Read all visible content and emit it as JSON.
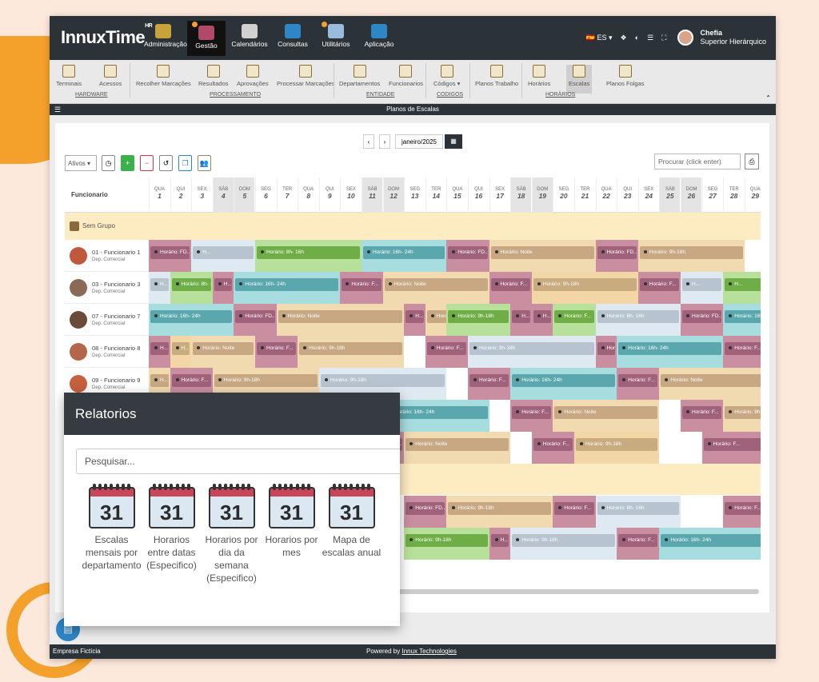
{
  "app": {
    "logo": "InnuxTime",
    "logo_sup": "HR"
  },
  "topnav": [
    {
      "label": "Administração",
      "icon": "gear-sun-icon",
      "alert": false
    },
    {
      "label": "Gestão",
      "icon": "network-icon",
      "alert": true,
      "active": true
    },
    {
      "label": "Calendários",
      "icon": "calendar-icon",
      "alert": false
    },
    {
      "label": "Consultas",
      "icon": "search-doc-icon",
      "alert": false
    },
    {
      "label": "Utilitários",
      "icon": "tools-icon",
      "alert": true
    },
    {
      "label": "Aplicação",
      "icon": "info-icon",
      "alert": false
    }
  ],
  "topright": {
    "lang": "ES",
    "user_role": "Chefia",
    "user_title": "Superior Hierárquico"
  },
  "ribbon": {
    "items": [
      "Terminais",
      "Acessos",
      "Recolher Marcações",
      "Resultados",
      "Aprovações",
      "Processar Marcações",
      "Departamentos",
      "Funcionarios",
      "Códigos ▾",
      "Planos Trabalho",
      "Horários",
      "Escalas",
      "Planos Folgas"
    ],
    "groups": [
      "HARDWARE",
      "PROCESSAMENTO",
      "ENTIDADE",
      "CODIGOS",
      "HORÁRIOS"
    ]
  },
  "title": "Planos de Escalas",
  "month": {
    "value": "janeiro/2025",
    "prev": "‹",
    "next": "›"
  },
  "toolbar": {
    "filter": "Ativos",
    "search_placeholder": "Procurar (click enter)"
  },
  "grid": {
    "col_header": "Funcionario",
    "days": [
      {
        "n": "QUA",
        "d": "1"
      },
      {
        "n": "QUI",
        "d": "2"
      },
      {
        "n": "SEX",
        "d": "3"
      },
      {
        "n": "SÁB",
        "d": "4"
      },
      {
        "n": "DOM",
        "d": "5"
      },
      {
        "n": "SEG",
        "d": "6"
      },
      {
        "n": "TER",
        "d": "7"
      },
      {
        "n": "QUA",
        "d": "8"
      },
      {
        "n": "QUI",
        "d": "9"
      },
      {
        "n": "SEX",
        "d": "10"
      },
      {
        "n": "SÁB",
        "d": "11"
      },
      {
        "n": "DOM",
        "d": "12"
      },
      {
        "n": "SEG",
        "d": "13"
      },
      {
        "n": "TER",
        "d": "14"
      },
      {
        "n": "QUA",
        "d": "15"
      },
      {
        "n": "QUI",
        "d": "16"
      },
      {
        "n": "SEX",
        "d": "17"
      },
      {
        "n": "SÁB",
        "d": "18"
      },
      {
        "n": "DOM",
        "d": "19"
      },
      {
        "n": "SEG",
        "d": "20"
      },
      {
        "n": "TER",
        "d": "21"
      },
      {
        "n": "QUA",
        "d": "22"
      },
      {
        "n": "QUI",
        "d": "23"
      },
      {
        "n": "SEX",
        "d": "24"
      },
      {
        "n": "SÁB",
        "d": "25"
      },
      {
        "n": "DOM",
        "d": "26"
      },
      {
        "n": "SEG",
        "d": "27"
      },
      {
        "n": "TER",
        "d": "28"
      },
      {
        "n": "QUA",
        "d": "29"
      }
    ],
    "group": "Sem Grupo",
    "employees": [
      {
        "name": "01 - Funcionario 1",
        "dept": "Dep. Comercial",
        "av": "#c0583b"
      },
      {
        "name": "03 - Funcionario 3",
        "dept": "Dep. Comercial",
        "av": "#8a6a55"
      },
      {
        "name": "07 - Funcionario 7",
        "dept": "Dep. Comercial",
        "av": "#6b4a3a"
      },
      {
        "name": "08 - Funcionario 8",
        "dept": "Dep. Comercial",
        "av": "#b5664a"
      },
      {
        "name": "09 - Funcionario 9",
        "dept": "Dep. Comercial",
        "av": "#c8603d"
      }
    ],
    "shift_labels": [
      "Horário: FD...",
      "Horário: 8h- 16h",
      "Horário: 16h- 24h",
      "Horário: Noite",
      "Horário: 9h-18h",
      "Horário: F...",
      "H..."
    ]
  },
  "modal": {
    "title": "Relatorios",
    "search_placeholder": "Pesquisar...",
    "calendar_number": "31",
    "reports": [
      "Escalas mensais por departamento",
      "Horarios entre datas (Especifico)",
      "Horarios por dia da semana (Especifico)",
      "Horarios por mes",
      "Mapa de escalas anual"
    ]
  },
  "footer": {
    "company": "Empresa Fictícia",
    "powered_prefix": "Powered by ",
    "powered_link": "Innux Technologies"
  }
}
